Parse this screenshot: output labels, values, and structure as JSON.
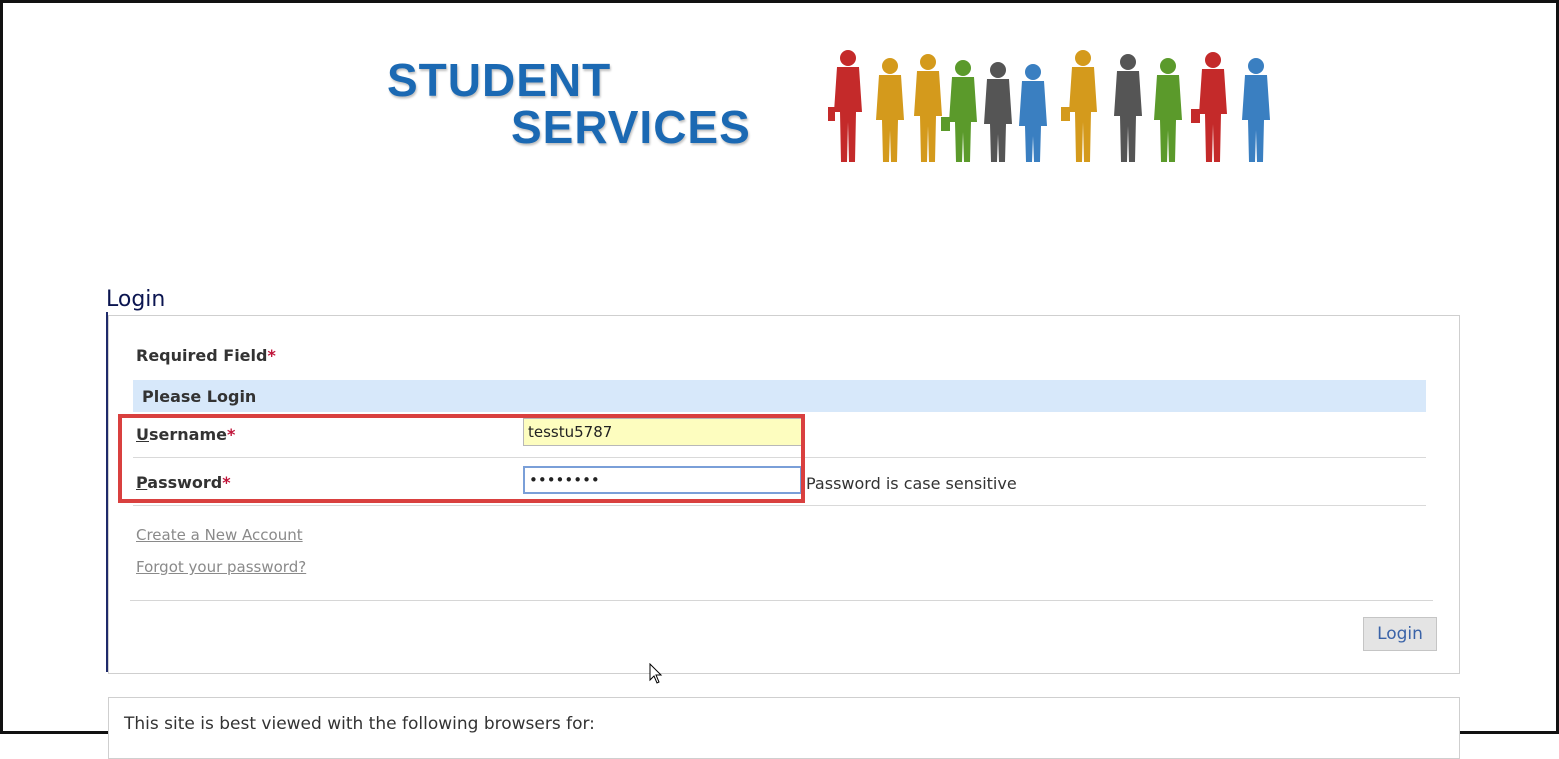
{
  "logo": {
    "line1": "STUDENT",
    "line2": "SERVICES",
    "people_icon": "people-silhouettes-icon",
    "colors": [
      "#c42a2a",
      "#d49a1c",
      "#5b9a2b",
      "#555555",
      "#3a7fc1"
    ]
  },
  "page": {
    "title": "Login"
  },
  "form": {
    "required_note": "Required Field",
    "required_marker": "*",
    "section_header": "Please Login",
    "username": {
      "label_first": "U",
      "label_rest": "sername",
      "value": "tesstu5787"
    },
    "password": {
      "label_first": "P",
      "label_rest": "assword",
      "value": "••••••••",
      "hint": "Password is case sensitive"
    },
    "links": {
      "create_account": "Create a New Account",
      "forgot_password": "Forgot your password?"
    },
    "submit_label": "Login"
  },
  "footer": {
    "browser_note": "This site is best viewed with the following browsers for:"
  },
  "colors": {
    "logo_blue": "#1b69b3",
    "header_bar": "#d7e8fa",
    "required_star": "#c0153a",
    "highlight_border": "#d9403f",
    "username_bg": "#fdfdbf"
  }
}
